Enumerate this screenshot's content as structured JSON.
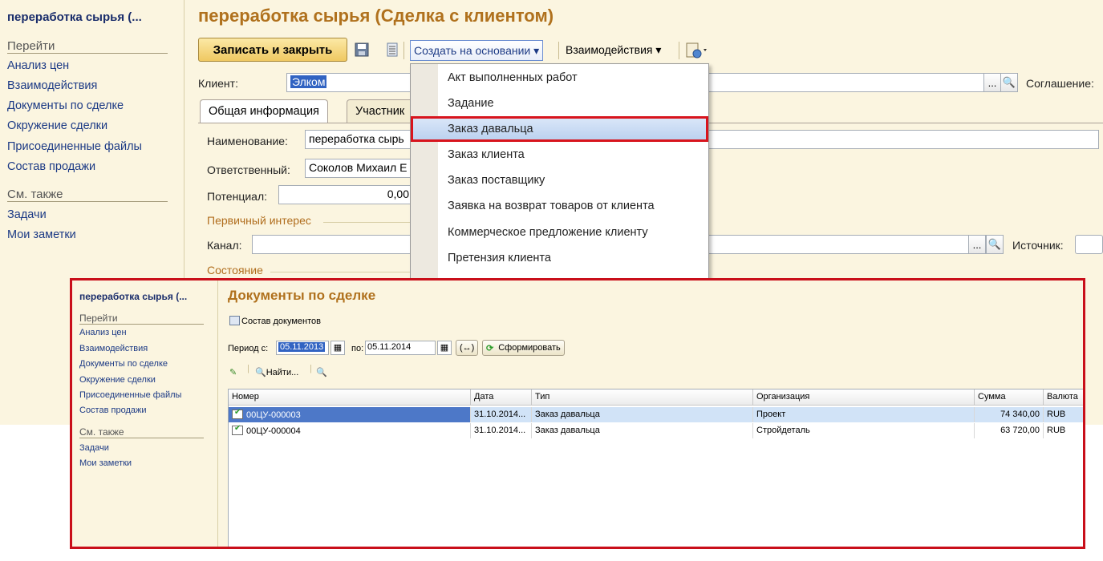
{
  "back_window": {
    "sidebar": {
      "title": "переработка сырья (...",
      "goto_head": "Перейти",
      "goto_items": [
        "Анализ цен",
        "Взаимодействия",
        "Документы по сделке",
        "Окружение сделки",
        "Присоединенные файлы",
        "Состав продажи"
      ],
      "see_also_head": "См. также",
      "see_also_items": [
        "Задачи",
        "Мои заметки"
      ]
    },
    "title": "переработка сырья (Сделка с клиентом)",
    "toolbar": {
      "save_close": "Записать и закрыть",
      "create_based": "Создать на основании ▾",
      "interactions": "Взаимодействия ▾"
    },
    "client_label": "Клиент:",
    "client_value": "Элком",
    "agreement_label": "Соглашение:",
    "tabs": [
      "Общая информация",
      "Участник"
    ],
    "name_label": "Наименование:",
    "name_value": "переработка сырь",
    "responsible_label": "Ответственный:",
    "responsible_value": "Соколов Михаил Е",
    "potential_label": "Потенциал:",
    "potential_value": "0,00",
    "primary_interest": "Первичный интерес",
    "channel_label": "Канал:",
    "source_label": "Источник:",
    "state_label": "Состояние"
  },
  "dropdown": {
    "items": [
      "Акт выполненных работ",
      "Задание",
      "Заказ давальца",
      "Заказ клиента",
      "Заказ поставщику",
      "Заявка на возврат товаров от клиента",
      "Коммерческое предложение клиенту",
      "Претензия клиента"
    ],
    "highlighted_index": 2
  },
  "front_window": {
    "sidebar": {
      "title": "переработка сырья (...",
      "goto_head": "Перейти",
      "goto_items": [
        "Анализ цен",
        "Взаимодействия",
        "Документы по сделке",
        "Окружение сделки",
        "Присоединенные файлы",
        "Состав продажи"
      ],
      "see_also_head": "См. также",
      "see_also_items": [
        "Задачи",
        "Мои заметки"
      ]
    },
    "title": "Документы по сделке",
    "docs_composition": "Состав документов",
    "period_from_label": "Период с:",
    "period_from": "05.11.2013",
    "period_to_label": "по:",
    "period_to": "05.11.2014",
    "ellipsis_btn": "(↔)",
    "generate_btn": "Сформировать",
    "find_btn": "Найти...",
    "columns": [
      "Номер",
      "Дата",
      "Тип",
      "Организация",
      "Сумма",
      "Валюта"
    ],
    "rows": [
      {
        "number": "00ЦУ-000003",
        "date": "31.10.2014...",
        "type": "Заказ давальца",
        "org": "Проект",
        "sum": "74 340,00",
        "currency": "RUB"
      },
      {
        "number": "00ЦУ-000004",
        "date": "31.10.2014...",
        "type": "Заказ давальца",
        "org": "Стройдеталь",
        "sum": "63 720,00",
        "currency": "RUB"
      }
    ]
  },
  "colors": {
    "title_orange": "#b0711d",
    "highlight_red": "#d8141d",
    "link_blue": "#1c3a85"
  }
}
